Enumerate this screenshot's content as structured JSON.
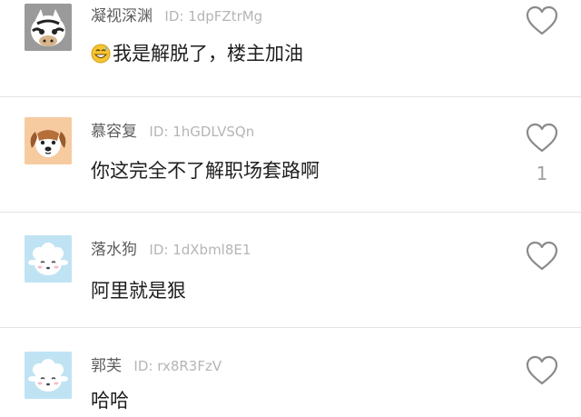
{
  "comments": [
    {
      "nickname": "凝视深渊",
      "uid": "ID: 1dpFZtrMg",
      "emoji": "grinning-sweat-emoji",
      "text": "我是解脱了，楼主加油",
      "avatar": "zebra-avatar",
      "likes": ""
    },
    {
      "nickname": "慕容复",
      "uid": "ID: 1hGDLVSQn",
      "text": "你这完全不了解职场套路啊",
      "avatar": "dog-avatar",
      "likes": "1"
    },
    {
      "nickname": "落水狗",
      "uid": "ID: 1dXbml8E1",
      "text": "阿里就是狠",
      "avatar": "sheep-avatar",
      "likes": ""
    },
    {
      "nickname": "郭芙",
      "uid": "ID: rx8R3FzV",
      "text": "哈哈",
      "avatar": "sheep-avatar",
      "likes": ""
    }
  ],
  "colors": {
    "heart_outline": "#8a8a8a",
    "divider": "#e3e3e3",
    "nickname": "#5c5c5c",
    "uid": "#b5b5b5"
  }
}
